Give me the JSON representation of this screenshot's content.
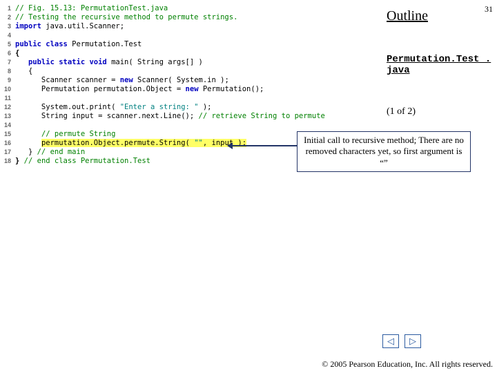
{
  "slide_number": "31",
  "outline_title": "Outline",
  "file_label": "Permutation.Test\n. java",
  "page_of": "(1 of 2)",
  "callout": "Initial call to recursive method; There are no removed characters yet, so first argument is “”",
  "copyright": "© 2005 Pearson Education,\nInc.  All rights reserved.",
  "nav": {
    "prev_glyph": "◁",
    "next_glyph": "▷"
  },
  "code": [
    {
      "n": "1",
      "segs": [
        {
          "cls": "c-comment",
          "t": "// Fig. 15.13: PermutationTest.java"
        }
      ]
    },
    {
      "n": "2",
      "segs": [
        {
          "cls": "c-comment",
          "t": "// Testing the recursive method to permute strings."
        }
      ]
    },
    {
      "n": "3",
      "segs": [
        {
          "cls": "c-keyword",
          "t": "import"
        },
        {
          "cls": "c-plain",
          "t": " java.util.Scanner;"
        }
      ]
    },
    {
      "n": "4",
      "segs": [
        {
          "cls": "c-plain",
          "t": ""
        }
      ]
    },
    {
      "n": "5",
      "segs": [
        {
          "cls": "c-keyword",
          "t": "public class"
        },
        {
          "cls": "c-plain",
          "t": " Permutation.Test"
        }
      ]
    },
    {
      "n": "6",
      "segs": [
        {
          "cls": "c-plain c-bold",
          "t": "{"
        }
      ]
    },
    {
      "n": "7",
      "segs": [
        {
          "cls": "c-plain",
          "t": "   "
        },
        {
          "cls": "c-keyword",
          "t": "public static void"
        },
        {
          "cls": "c-plain",
          "t": " main( String args[] )"
        }
      ]
    },
    {
      "n": "8",
      "segs": [
        {
          "cls": "c-plain",
          "t": "   {"
        }
      ]
    },
    {
      "n": "9",
      "segs": [
        {
          "cls": "c-plain",
          "t": "      Scanner scanner = "
        },
        {
          "cls": "c-keyword",
          "t": "new"
        },
        {
          "cls": "c-plain",
          "t": " Scanner( System.in );"
        }
      ]
    },
    {
      "n": "10",
      "segs": [
        {
          "cls": "c-plain",
          "t": "      Permutation permutation.Object = "
        },
        {
          "cls": "c-keyword",
          "t": "new"
        },
        {
          "cls": "c-plain",
          "t": " Permutation();"
        }
      ]
    },
    {
      "n": "11",
      "segs": [
        {
          "cls": "c-plain",
          "t": ""
        }
      ]
    },
    {
      "n": "12",
      "segs": [
        {
          "cls": "c-plain",
          "t": "      System.out.print( "
        },
        {
          "cls": "c-string",
          "t": "\"Enter a string: \""
        },
        {
          "cls": "c-plain",
          "t": " );"
        }
      ]
    },
    {
      "n": "13",
      "segs": [
        {
          "cls": "c-plain",
          "t": "      String input = scanner.next.Line(); "
        },
        {
          "cls": "c-comment",
          "t": "// retrieve String to permute"
        }
      ]
    },
    {
      "n": "14",
      "segs": [
        {
          "cls": "c-plain",
          "t": ""
        }
      ]
    },
    {
      "n": "15",
      "segs": [
        {
          "cls": "c-plain",
          "t": "      "
        },
        {
          "cls": "c-comment",
          "t": "// permute String"
        }
      ]
    },
    {
      "n": "16",
      "segs": [
        {
          "cls": "c-plain",
          "t": "      "
        },
        {
          "cls": "c-plain hl",
          "t": "permutation.Object.permute.String( "
        },
        {
          "cls": "c-string hl",
          "t": "\"\""
        },
        {
          "cls": "c-plain hl",
          "t": ", input );"
        }
      ]
    },
    {
      "n": "17",
      "segs": [
        {
          "cls": "c-plain",
          "t": "   } "
        },
        {
          "cls": "c-comment",
          "t": "// end main"
        }
      ]
    },
    {
      "n": "18",
      "segs": [
        {
          "cls": "c-plain c-bold",
          "t": "} "
        },
        {
          "cls": "c-comment",
          "t": "// end class Permutation.Test"
        }
      ]
    }
  ]
}
